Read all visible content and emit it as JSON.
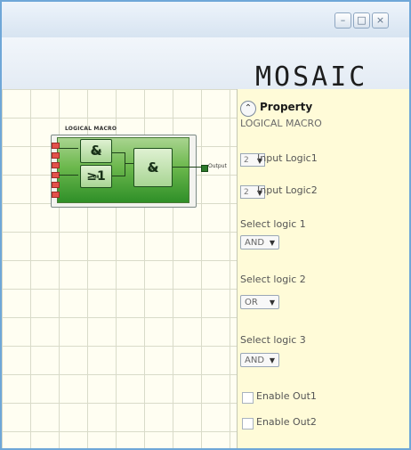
{
  "window": {
    "controls": [
      "–",
      "□",
      "×"
    ],
    "logo": "MOSAIC"
  },
  "macro": {
    "title": "LOGICAL MACRO",
    "gate1": {
      "tag": "AND",
      "symbol": "&"
    },
    "gate2": {
      "tag": "OR",
      "symbol": "≥1"
    },
    "gate3": {
      "tag": "AND",
      "symbol": "&"
    },
    "output_label": "Output"
  },
  "property_panel": {
    "title": "Property",
    "macro_name": "LOGICAL MACRO",
    "input_logic1": {
      "value": "2",
      "label": "Input Logic1"
    },
    "input_logic2": {
      "value": "2",
      "label": "Input Logic2"
    },
    "select_logic1": {
      "label": "Select logic 1",
      "value": "AND"
    },
    "select_logic2": {
      "label": "Select logic 2",
      "value": "OR"
    },
    "select_logic3": {
      "label": "Select logic 3",
      "value": "AND"
    },
    "enable_out1": {
      "label": "Enable Out1"
    },
    "enable_out2": {
      "label": "Enable Out2"
    }
  }
}
